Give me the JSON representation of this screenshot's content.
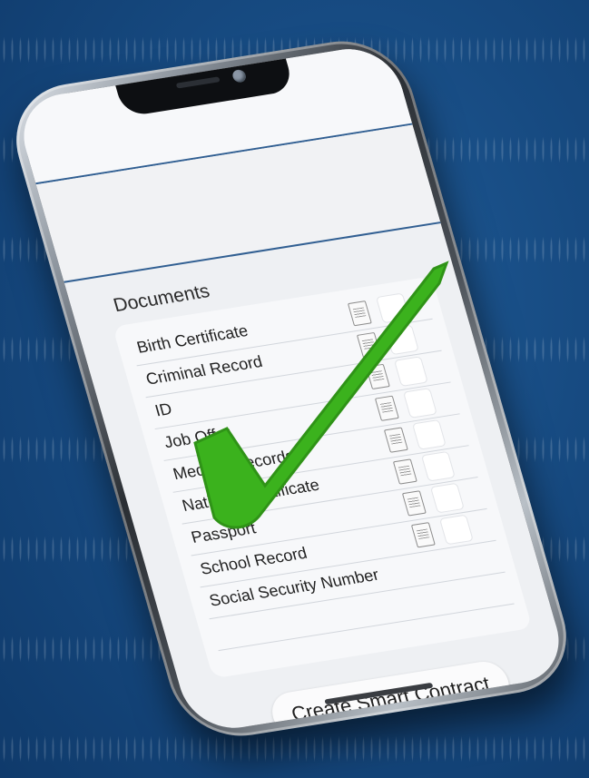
{
  "screen": {
    "section_title": "Documents",
    "documents": [
      {
        "label": "Birth Certificate"
      },
      {
        "label": "Criminal Record"
      },
      {
        "label": "ID"
      },
      {
        "label": "Job Offer"
      },
      {
        "label": "Medical Records"
      },
      {
        "label": "National Certificate"
      },
      {
        "label": "Passport"
      },
      {
        "label": "School Record"
      },
      {
        "label": "Social Security Number"
      }
    ],
    "action_button_label": "Create Smart Contract"
  },
  "icons": {
    "document": "document-icon",
    "checkmark": "checkmark-icon"
  },
  "colors": {
    "background": "#174b82",
    "accent_line": "#315f92",
    "checkmark": "#3bb21d"
  }
}
